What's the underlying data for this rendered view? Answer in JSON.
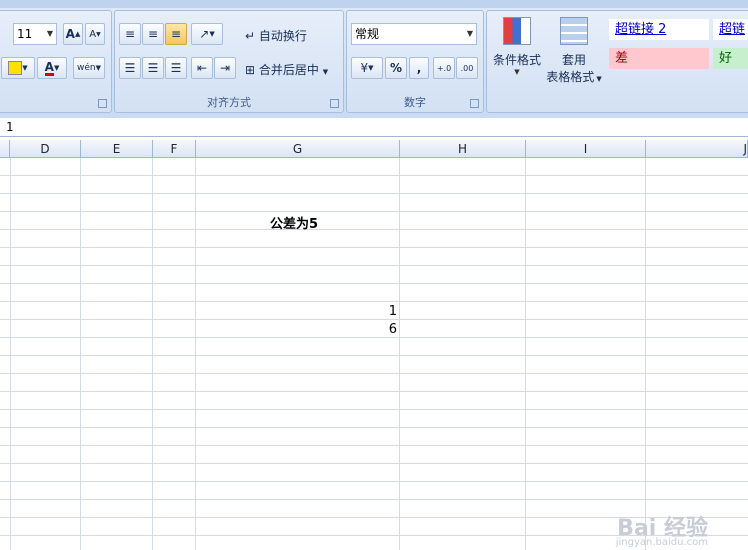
{
  "ribbon": {
    "font_size": "11",
    "grow_font": "A",
    "shrink_font": "A",
    "phonetic": "wén",
    "wrap_text": "自动换行",
    "merge_center": "合并后居中",
    "alignment_label": "对齐方式",
    "number_format": "常规",
    "percent": "%",
    "comma": ",",
    "inc_decimal": "+.0",
    "dec_decimal": ".00",
    "number_label": "数字",
    "cond_format": "条件格式",
    "table_format_1": "套用",
    "table_format_2": "表格格式",
    "styles": {
      "hyperlink2": "超链接 2",
      "hyperlink": "超链",
      "bad": "差",
      "good": "好"
    }
  },
  "formula_bar": {
    "value": "1"
  },
  "columns": [
    "D",
    "E",
    "F",
    "G",
    "H",
    "I",
    "J"
  ],
  "cells": {
    "title": "公差为5",
    "v1": "1",
    "v2": "6"
  },
  "watermark": {
    "brand": "Bai 经验",
    "url": "jingyan.baidu.com"
  },
  "colors": {
    "bad_bg": "#ffc7ce",
    "bad_fg": "#9c0006",
    "good_bg": "#c6efce",
    "good_fg": "#006100"
  }
}
